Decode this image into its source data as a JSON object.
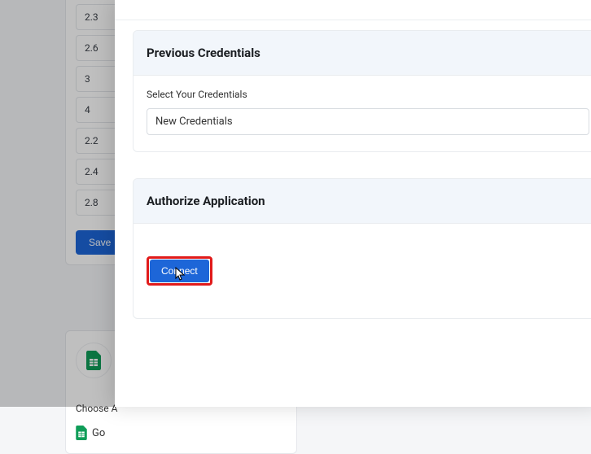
{
  "bg": {
    "versions": [
      "2.3",
      "2.6",
      "3",
      "4",
      "2.2",
      "2.4",
      "2.8"
    ],
    "save_label": "Save",
    "choose_label": "Choose A",
    "app_name": "Go"
  },
  "panel": {
    "prev_cred": {
      "title": "Previous Credentials",
      "select_label": "Select Your Credentials",
      "selected": "New Credentials"
    },
    "authorize": {
      "title": "Authorize Application",
      "connect_label": "Connect"
    }
  }
}
